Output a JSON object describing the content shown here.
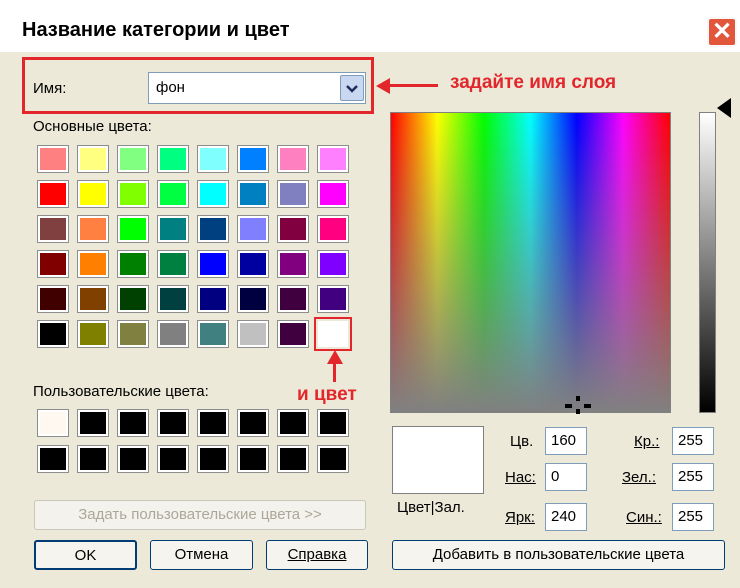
{
  "window": {
    "title": "Название категории и цвет"
  },
  "name_field": {
    "label": "Имя:",
    "value": "фон"
  },
  "annotations": {
    "name_hint": "задайте имя слоя",
    "color_hint": "и цвет"
  },
  "basic_colors": {
    "label": "Основные цвета:",
    "rows": [
      [
        "#ff8080",
        "#ffff80",
        "#80ff80",
        "#00ff80",
        "#80ffff",
        "#0080ff",
        "#ff80c0",
        "#ff80ff"
      ],
      [
        "#ff0000",
        "#ffff00",
        "#80ff00",
        "#00ff40",
        "#00ffff",
        "#0080c0",
        "#8080c0",
        "#ff00ff"
      ],
      [
        "#804040",
        "#ff8040",
        "#00ff00",
        "#008080",
        "#004080",
        "#8080ff",
        "#800040",
        "#ff0080"
      ],
      [
        "#800000",
        "#ff8000",
        "#008000",
        "#008040",
        "#0000ff",
        "#0000a0",
        "#800080",
        "#8000ff"
      ],
      [
        "#400000",
        "#804000",
        "#004000",
        "#004040",
        "#000080",
        "#000040",
        "#400040",
        "#400080"
      ],
      [
        "#000000",
        "#808000",
        "#808040",
        "#808080",
        "#408080",
        "#c0c0c0",
        "#400040",
        "#ffffff"
      ]
    ]
  },
  "custom_colors": {
    "label": "Пользовательские цвета:",
    "rows": [
      [
        "#fff8f0",
        "#000000",
        "#000000",
        "#000000",
        "#000000",
        "#000000",
        "#000000",
        "#000000"
      ],
      [
        "#000000",
        "#000000",
        "#000000",
        "#000000",
        "#000000",
        "#000000",
        "#000000",
        "#000000"
      ]
    ]
  },
  "buttons": {
    "define_custom": "Задать пользовательские цвета >>",
    "ok": "OK",
    "cancel": "Отмена",
    "help": "Справка",
    "add_custom": "Добавить в пользовательские цвета"
  },
  "preview_label": "Цвет|Зал.",
  "hsl": [
    {
      "label": "Цв.",
      "value": "160"
    },
    {
      "label": "Нас:",
      "value": "0"
    },
    {
      "label": "Ярк:",
      "value": "240"
    }
  ],
  "rgb": [
    {
      "label": "Кр.:",
      "value": "255"
    },
    {
      "label": "Зел.:",
      "value": "255"
    },
    {
      "label": "Син.:",
      "value": "255"
    }
  ]
}
